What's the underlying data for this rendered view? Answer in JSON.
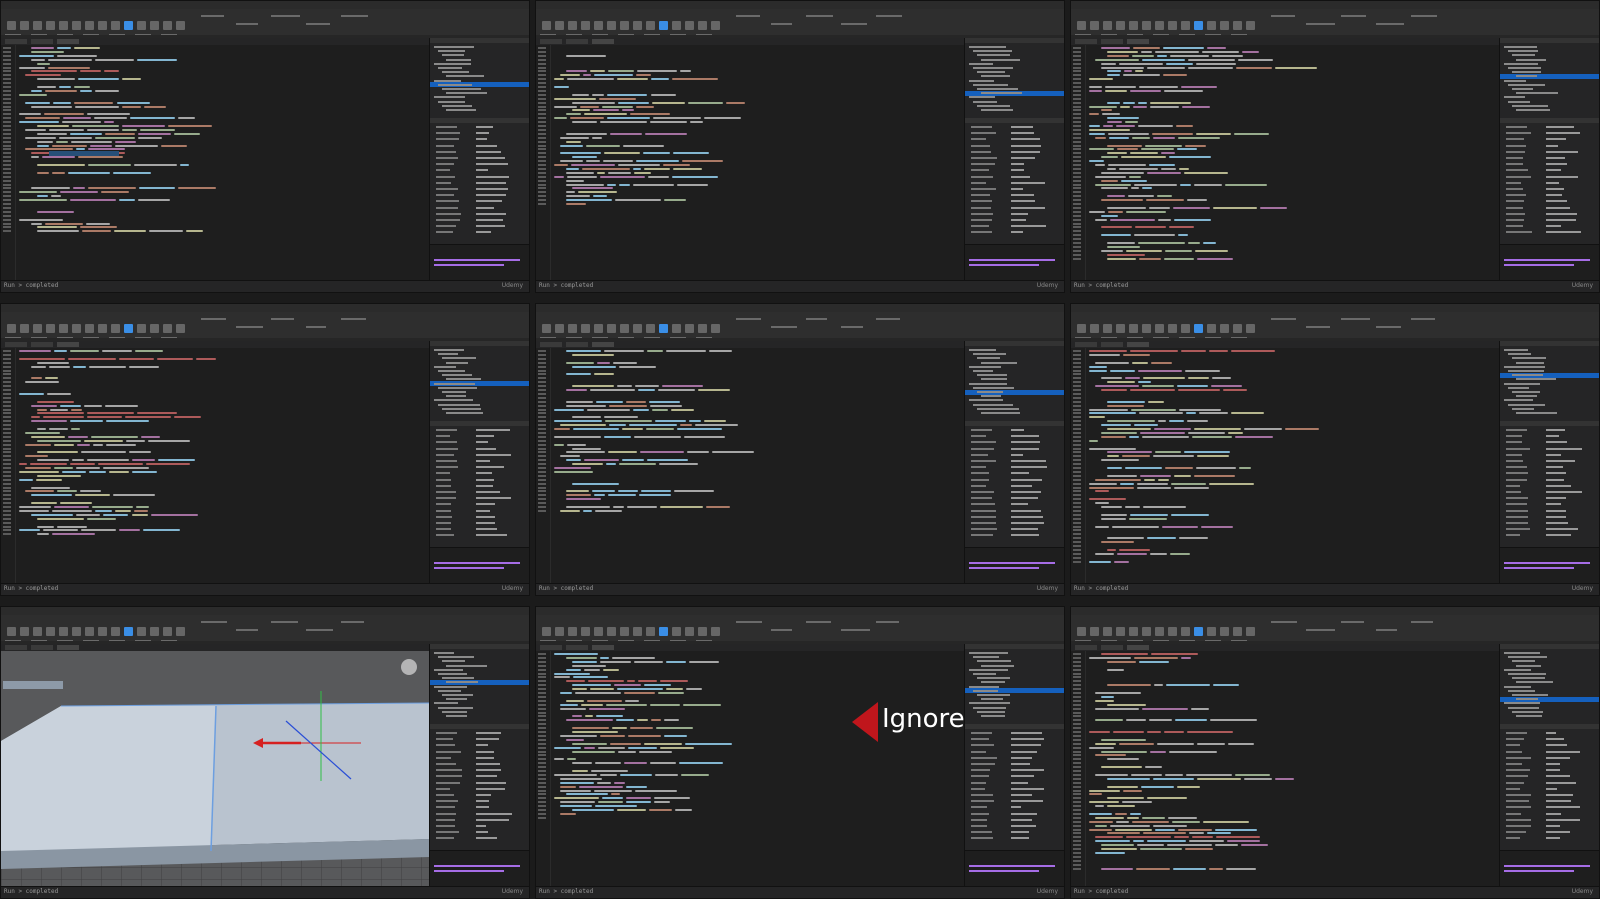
{
  "status_text": "Run > completed",
  "watermark": "Udemy",
  "overlay": {
    "ignore_label": "Ignore"
  },
  "colors": {
    "keyword": "#c586c0",
    "func": "#dcdcaa",
    "string": "#ce9178",
    "comment": "#d16969",
    "ident": "#9cdcfe",
    "plain": "#c8c8c8",
    "number": "#b5cea8",
    "selection": "#1560bd",
    "play": "#3a8ee6",
    "arrow": "#c0161c"
  },
  "tiles": [
    {
      "id": "tile-1",
      "kind": "code"
    },
    {
      "id": "tile-2",
      "kind": "code"
    },
    {
      "id": "tile-3",
      "kind": "code"
    },
    {
      "id": "tile-4",
      "kind": "code"
    },
    {
      "id": "tile-5",
      "kind": "code"
    },
    {
      "id": "tile-6",
      "kind": "code"
    },
    {
      "id": "tile-7",
      "kind": "viewport"
    },
    {
      "id": "tile-8",
      "kind": "code"
    },
    {
      "id": "tile-9",
      "kind": "code"
    }
  ]
}
